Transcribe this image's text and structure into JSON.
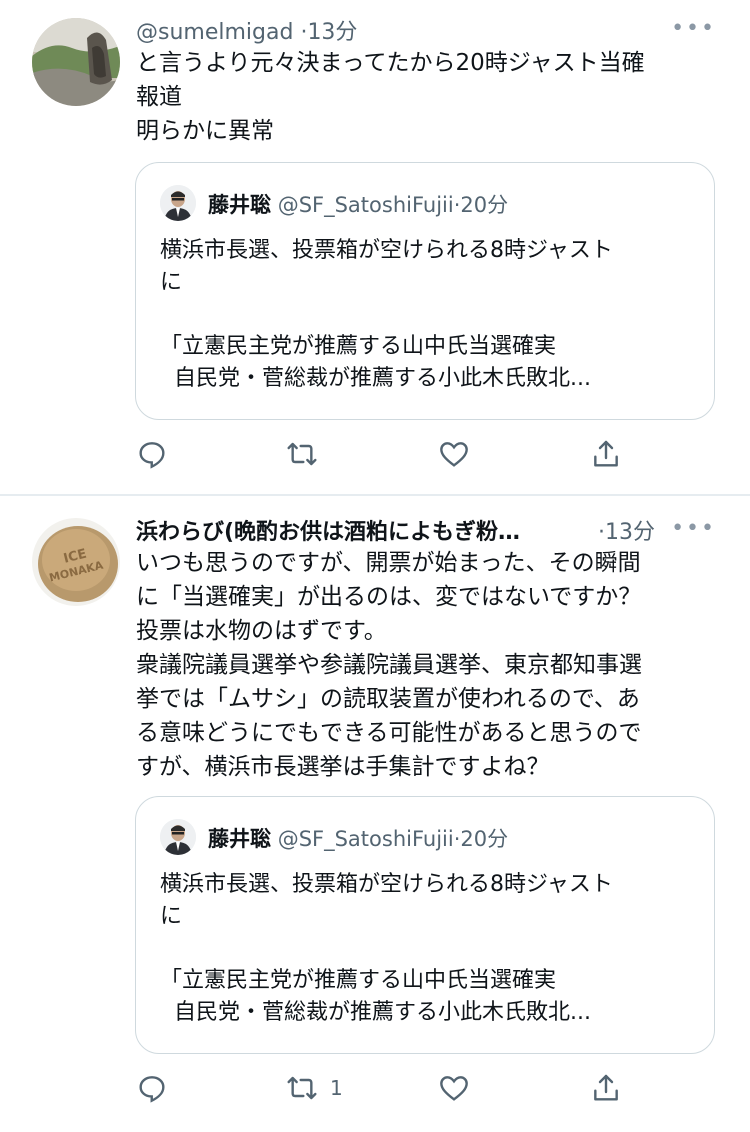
{
  "tweets": [
    {
      "author": {
        "display_name": "",
        "handle": "@sumelmigad",
        "time": "13分"
      },
      "text_lines": [
        "と言うより元々決まってたから20時ジャスト当確",
        "報道",
        "明らかに異常"
      ],
      "quoted": {
        "name": "藤井聡",
        "handle": "@SF_SatoshiFujii",
        "time": "20分",
        "text_lines": [
          "横浜市長選、投票箱が空けられる8時ジャスト",
          "に",
          "",
          "「立憲民主党が推薦する山中氏当選確実",
          "  自民党・菅総裁が推薦する小此木氏敗北..."
        ]
      },
      "actions": {
        "reply_count": "",
        "retweet_count": "",
        "like_count": ""
      }
    },
    {
      "author": {
        "display_name": "浜わらび(晩酌お供は酒粕によもぎ粉…",
        "handle": "",
        "time": "13分"
      },
      "avatar_text": "ICE MONAKA",
      "text_lines": [
        "いつも思うのですが、開票が始まった、その瞬間",
        "に「当選確実」が出るのは、変ではないですか？",
        "投票は水物のはずです。",
        "衆議院議員選挙や参議院議員選挙、東京都知事選",
        "挙では「ムサシ」の読取装置が使われるので、あ",
        "る意味どうにでもできる可能性があると思うので",
        "すが、横浜市長選挙は手集計ですよね？"
      ],
      "quoted": {
        "name": "藤井聡",
        "handle": "@SF_SatoshiFujii",
        "time": "20分",
        "text_lines": [
          "横浜市長選、投票箱が空けられる8時ジャスト",
          "に",
          "",
          "「立憲民主党が推薦する山中氏当選確実",
          "  自民党・菅総裁が推薦する小此木氏敗北..."
        ]
      },
      "actions": {
        "reply_count": "",
        "retweet_count": "1",
        "like_count": ""
      }
    }
  ],
  "ui": {
    "separator": "·",
    "more_glyph": "•••"
  },
  "colors": {
    "text": "#0f1419",
    "muted": "#536471",
    "border": "#cfd9de",
    "icon": "#536471"
  }
}
